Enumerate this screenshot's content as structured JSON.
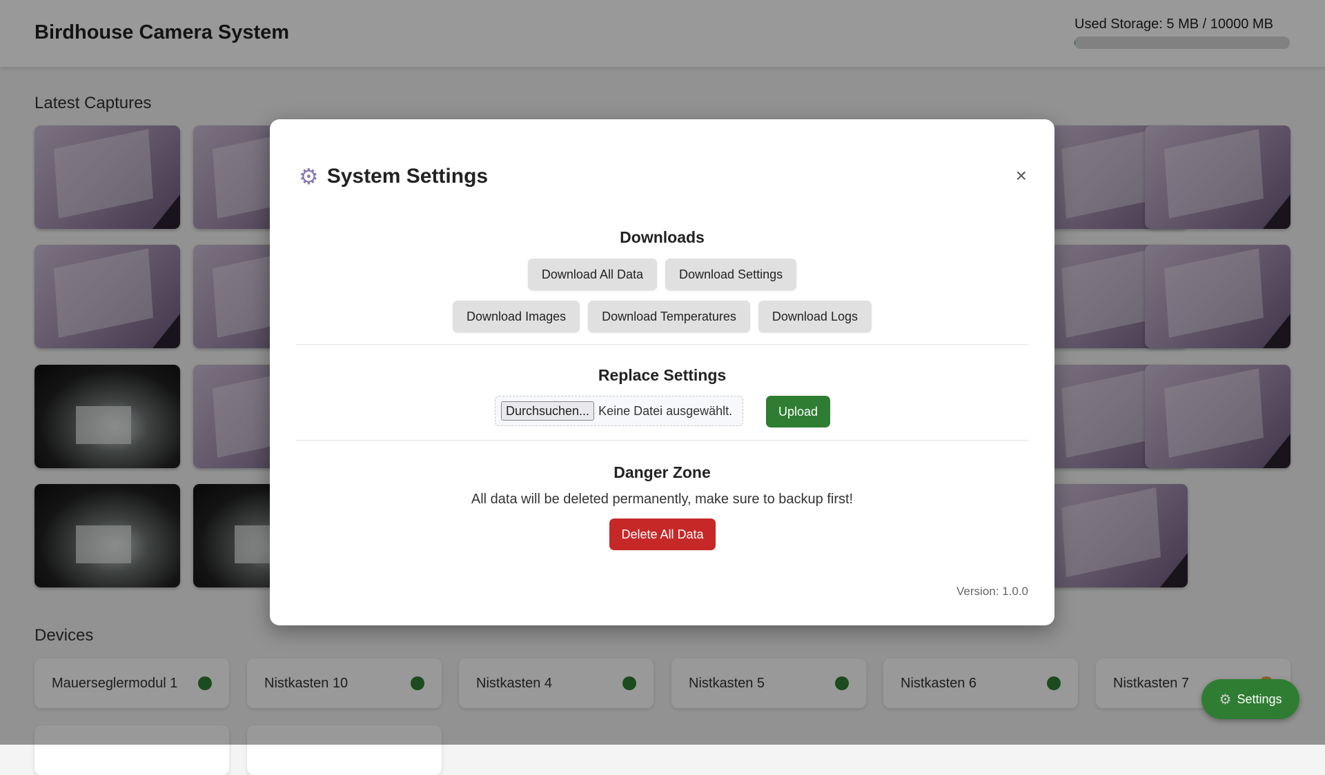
{
  "app": {
    "title": "Birdhouse Camera System"
  },
  "storage": {
    "label": "Used Storage: 5 MB / 10000 MB",
    "used_mb": 5,
    "total_mb": 10000,
    "fill_fraction": 0.0005
  },
  "captures": {
    "title": "Latest Captures",
    "thumbnails": [
      "purple",
      "purple",
      "purple",
      "purple",
      "purple",
      "purple",
      "purple",
      "purple",
      "dark",
      "purple",
      "purple",
      "purple",
      "dark",
      "dark",
      "purple"
    ]
  },
  "devices": {
    "title": "Devices",
    "items": [
      {
        "name": "Mauerseglermodul 1",
        "status_color": "#2e7d32"
      },
      {
        "name": "Nistkasten 10",
        "status_color": "#2e7d32"
      },
      {
        "name": "Nistkasten 4",
        "status_color": "#2e7d32"
      },
      {
        "name": "Nistkasten 5",
        "status_color": "#2e7d32"
      },
      {
        "name": "Nistkasten 6",
        "status_color": "#2e7d32"
      },
      {
        "name": "Nistkasten 7",
        "status_color": "#e6a23c"
      }
    ]
  },
  "fab": {
    "label": "Settings",
    "icon": "gear-icon"
  },
  "modal": {
    "title": "System Settings",
    "icon": "gear-icon",
    "close": "×",
    "downloads": {
      "title": "Downloads",
      "all_data": "Download All Data",
      "settings": "Download Settings",
      "images": "Download Images",
      "temperatures": "Download Temperatures",
      "logs": "Download Logs"
    },
    "replace": {
      "title": "Replace Settings",
      "browse": "Durchsuchen...",
      "no_file": "Keine Datei ausgewählt.",
      "upload": "Upload"
    },
    "danger": {
      "title": "Danger Zone",
      "warning": "All data will be deleted permanently, make sure to backup first!",
      "delete": "Delete All Data"
    },
    "version": "Version: 1.0.0"
  },
  "colors": {
    "accent_green": "#2e7d32",
    "danger_red": "#c62828",
    "overlay": "rgba(0,0,0,0.4)"
  }
}
